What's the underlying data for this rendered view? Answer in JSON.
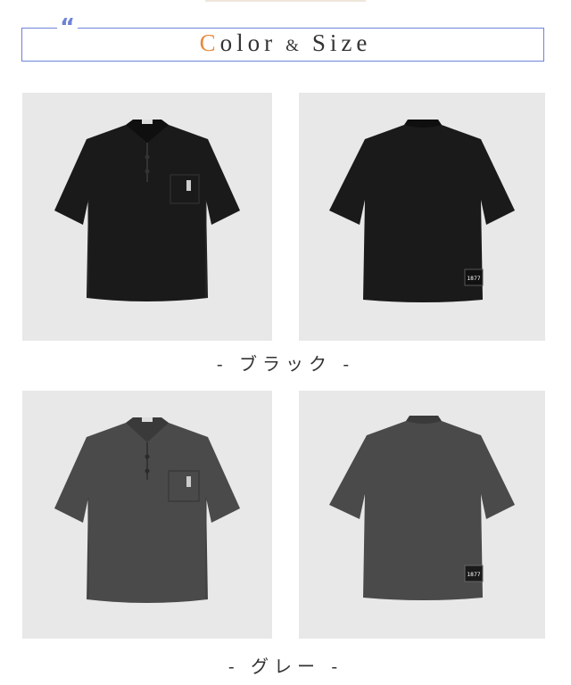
{
  "header": {
    "quote_mark": "“",
    "title_first_letter": "C",
    "title_rest_1": "olor",
    "title_amp": "&",
    "title_rest_2": "Size"
  },
  "colors": {
    "accent_blue": "#6f83d6",
    "accent_orange": "#e88a3c",
    "panel_bg": "#e8e8e8",
    "black_shirt": "#1a1a1a",
    "gray_shirt": "#4a4a4a"
  },
  "rows": [
    {
      "caption": "- ブラック -",
      "label_text": "1877"
    },
    {
      "caption": "- グレー -",
      "label_text": "1877"
    }
  ]
}
